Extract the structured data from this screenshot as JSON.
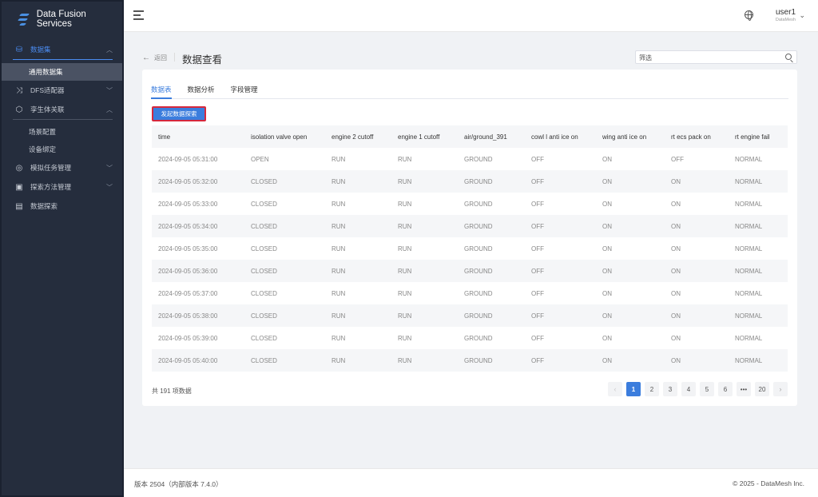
{
  "app": {
    "title": "Data Fusion Services"
  },
  "sidebar": {
    "items": [
      {
        "label": "数据集",
        "icon": "database-icon",
        "expanded": true,
        "active": true
      },
      {
        "label": "通用数据集",
        "sub": true,
        "selected": true
      },
      {
        "label": "DFS适配器",
        "icon": "shuffle-icon"
      },
      {
        "label": "孪生体关联",
        "icon": "cube-icon",
        "expanded": true
      },
      {
        "label": "场景配置",
        "sub": true
      },
      {
        "label": "设备绑定",
        "sub": true
      },
      {
        "label": "模拟任务管理",
        "icon": "simulation-icon"
      },
      {
        "label": "探索方法管理",
        "icon": "method-icon"
      },
      {
        "label": "数据探索",
        "icon": "explore-icon"
      }
    ]
  },
  "header": {
    "user_name": "user1",
    "org": "DataMesh"
  },
  "page": {
    "back_label": "返回",
    "title": "数据查看",
    "filter_placeholder": "筛选"
  },
  "tabs": [
    {
      "label": "数据表",
      "active": true
    },
    {
      "label": "数据分析"
    },
    {
      "label": "字段管理"
    }
  ],
  "explore_button_label": "发起数据探索",
  "table": {
    "columns": [
      "time",
      "isolation valve open",
      "engine 2 cutoff",
      "engine 1 cutoff",
      "air/ground_391",
      "cowl l anti ice on",
      "wing anti ice on",
      "rt ecs pack on",
      "rt engine fail"
    ],
    "rows": [
      [
        "2024-09-05 05:31:00",
        "OPEN",
        "RUN",
        "RUN",
        "GROUND",
        "OFF",
        "ON",
        "OFF",
        "NORMAL"
      ],
      [
        "2024-09-05 05:32:00",
        "CLOSED",
        "RUN",
        "RUN",
        "GROUND",
        "OFF",
        "ON",
        "ON",
        "NORMAL"
      ],
      [
        "2024-09-05 05:33:00",
        "CLOSED",
        "RUN",
        "RUN",
        "GROUND",
        "OFF",
        "ON",
        "ON",
        "NORMAL"
      ],
      [
        "2024-09-05 05:34:00",
        "CLOSED",
        "RUN",
        "RUN",
        "GROUND",
        "OFF",
        "ON",
        "ON",
        "NORMAL"
      ],
      [
        "2024-09-05 05:35:00",
        "CLOSED",
        "RUN",
        "RUN",
        "GROUND",
        "OFF",
        "ON",
        "ON",
        "NORMAL"
      ],
      [
        "2024-09-05 05:36:00",
        "CLOSED",
        "RUN",
        "RUN",
        "GROUND",
        "OFF",
        "ON",
        "ON",
        "NORMAL"
      ],
      [
        "2024-09-05 05:37:00",
        "CLOSED",
        "RUN",
        "RUN",
        "GROUND",
        "OFF",
        "ON",
        "ON",
        "NORMAL"
      ],
      [
        "2024-09-05 05:38:00",
        "CLOSED",
        "RUN",
        "RUN",
        "GROUND",
        "OFF",
        "ON",
        "ON",
        "NORMAL"
      ],
      [
        "2024-09-05 05:39:00",
        "CLOSED",
        "RUN",
        "RUN",
        "GROUND",
        "OFF",
        "ON",
        "ON",
        "NORMAL"
      ],
      [
        "2024-09-05 05:40:00",
        "CLOSED",
        "RUN",
        "RUN",
        "GROUND",
        "OFF",
        "ON",
        "ON",
        "NORMAL"
      ]
    ]
  },
  "pagination": {
    "total_text": "共 191 项数据",
    "prev": "‹",
    "next": "›",
    "pages": [
      "1",
      "2",
      "3",
      "4",
      "5",
      "6",
      "•••",
      "20"
    ],
    "current": "1"
  },
  "footer": {
    "version": "版本 2504（内部版本 7.4.0）",
    "copyright": "© 2025 - DataMesh Inc."
  },
  "colors": {
    "primary": "#3b7ddd",
    "sidebar_bg": "#252d3d",
    "highlight_border": "#d6283c"
  }
}
